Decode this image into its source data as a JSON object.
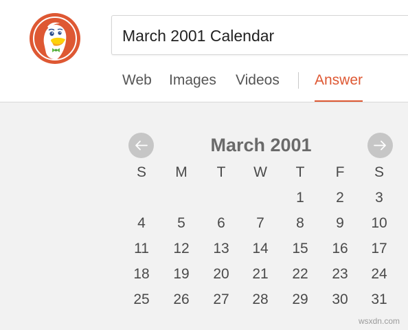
{
  "search": {
    "query": "March 2001 Calendar"
  },
  "tabs": [
    {
      "label": "Web",
      "active": false
    },
    {
      "label": "Images",
      "active": false
    },
    {
      "label": "Videos",
      "active": false
    },
    {
      "label": "Answer",
      "active": true
    }
  ],
  "colors": {
    "accent": "#de5833",
    "content_bg": "#f2f2f2",
    "nav_button": "#c6c6c6"
  },
  "icons": {
    "logo": "duckduckgo-logo-icon",
    "prev": "arrow-left-icon",
    "next": "arrow-right-icon"
  },
  "calendar": {
    "title": "March 2001",
    "weekdays": [
      "S",
      "M",
      "T",
      "W",
      "T",
      "F",
      "S"
    ],
    "weeks": [
      [
        "",
        "",
        "",
        "",
        "1",
        "2",
        "3"
      ],
      [
        "4",
        "5",
        "6",
        "7",
        "8",
        "9",
        "10"
      ],
      [
        "11",
        "12",
        "13",
        "14",
        "15",
        "16",
        "17"
      ],
      [
        "18",
        "19",
        "20",
        "21",
        "22",
        "23",
        "24"
      ],
      [
        "25",
        "26",
        "27",
        "28",
        "29",
        "30",
        "31"
      ]
    ]
  },
  "watermark": "wsxdn.com"
}
